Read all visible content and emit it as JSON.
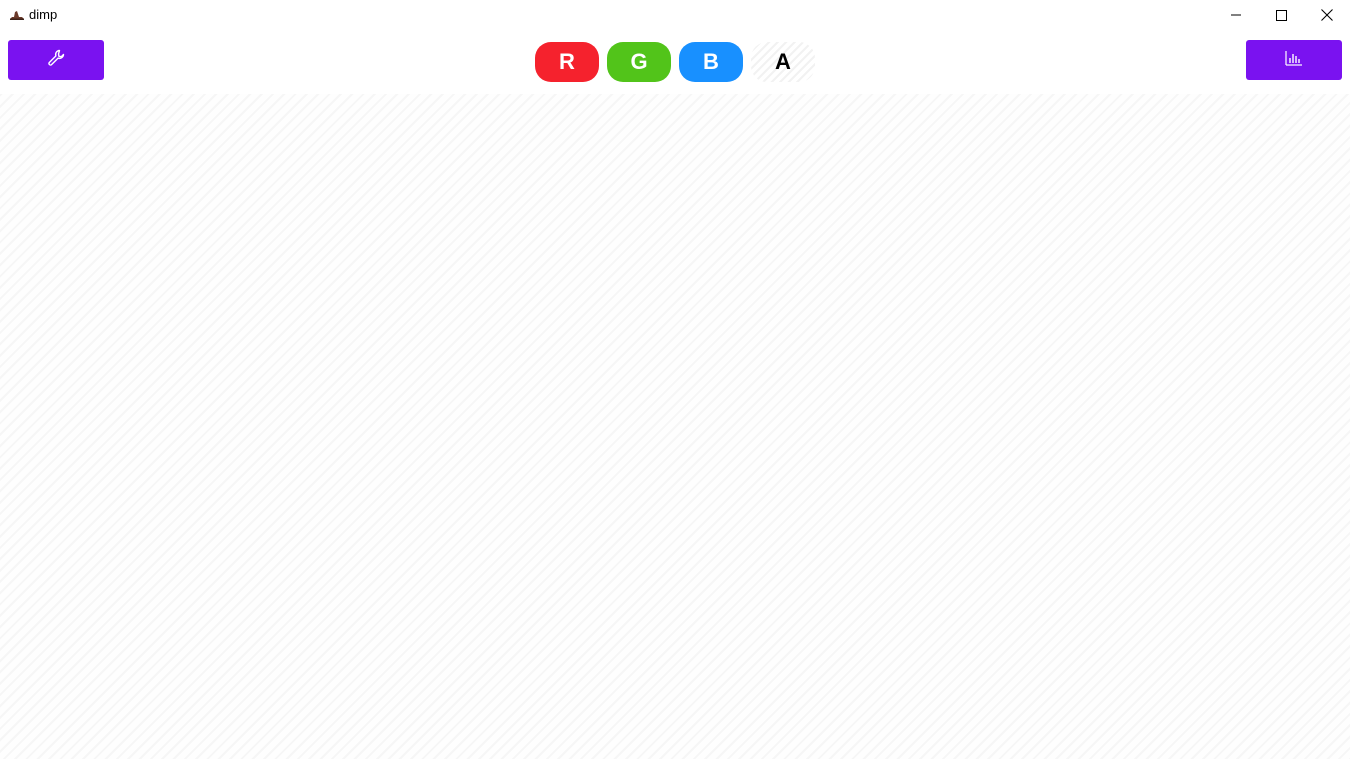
{
  "window": {
    "title": "dimp",
    "app_icon": "hat-icon"
  },
  "controls": {
    "minimize_icon": "minimize-icon",
    "maximize_icon": "maximize-icon",
    "close_icon": "close-icon"
  },
  "toolbar": {
    "settings_icon": "wrench-icon",
    "histogram_icon": "bar-chart-icon",
    "accent_color": "#7a12f0"
  },
  "channels": [
    {
      "label": "R",
      "color": "#f5222d"
    },
    {
      "label": "G",
      "color": "#52c41a"
    },
    {
      "label": "B",
      "color": "#1890ff"
    },
    {
      "label": "A",
      "color": "transparent"
    }
  ],
  "canvas": {
    "background": "checkerboard-stripes"
  }
}
